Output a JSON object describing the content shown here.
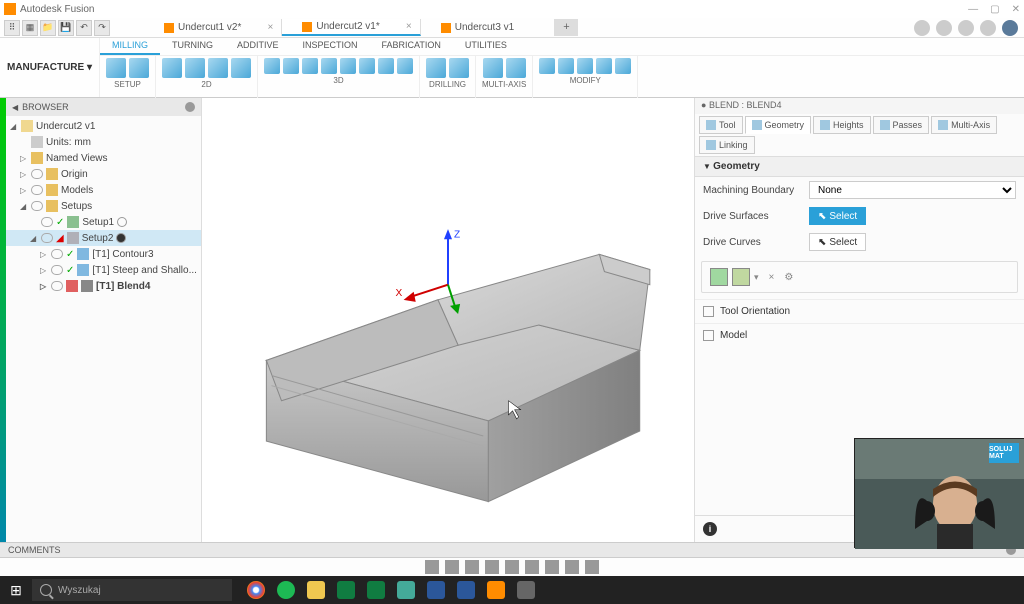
{
  "app": {
    "title": "Autodesk Fusion"
  },
  "doc_tabs": [
    {
      "label": "Undercut1 v2*",
      "active": false
    },
    {
      "label": "Undercut2 v1*",
      "active": true
    },
    {
      "label": "Undercut3 v1",
      "active": false
    }
  ],
  "workspace": {
    "label": "MANUFACTURE"
  },
  "ribbon_tabs": [
    "MILLING",
    "TURNING",
    "ADDITIVE",
    "INSPECTION",
    "FABRICATION",
    "UTILITIES"
  ],
  "ribbon_active": "MILLING",
  "ribbon_groups": [
    {
      "label": "SETUP",
      "icons": 2
    },
    {
      "label": "2D",
      "icons": 4
    },
    {
      "label": "3D",
      "icons": 8
    },
    {
      "label": "DRILLING",
      "icons": 2
    },
    {
      "label": "MULTI-AXIS",
      "icons": 2
    },
    {
      "label": "MODIFY",
      "icons": 5
    }
  ],
  "browser": {
    "title": "BROWSER",
    "root": "Undercut2 v1",
    "units": "Units: mm",
    "named_views": "Named Views",
    "origin": "Origin",
    "models": "Models",
    "setups": "Setups",
    "setup1": "Setup1",
    "setup2": "Setup2",
    "op1": "[T1] Contour3",
    "op2": "[T1] Steep and Shallo...",
    "op3": "[T1] Blend4"
  },
  "comments": {
    "label": "COMMENTS"
  },
  "prop": {
    "breadcrumb": "BLEND : BLEND4",
    "tabs": [
      "Tool",
      "Geometry",
      "Heights",
      "Passes",
      "Multi-Axis",
      "Linking"
    ],
    "active_tab": "Geometry",
    "section_geom": "Geometry",
    "machining_boundary_label": "Machining Boundary",
    "machining_boundary_value": "None",
    "drive_surfaces_label": "Drive Surfaces",
    "drive_curves_label": "Drive Curves",
    "select_label": "Select",
    "tool_orientation": "Tool Orientation",
    "model": "Model"
  },
  "taskbar": {
    "search_placeholder": "Wyszukaj",
    "apps": [
      "chrome",
      "spotify",
      "file",
      "excel",
      "excel2",
      "image",
      "word",
      "word2",
      "fusion",
      "explorer"
    ]
  },
  "axes": {
    "x": "X",
    "y": "Y",
    "z": "Z"
  },
  "webcam_logo": "SOLUJ MAT"
}
